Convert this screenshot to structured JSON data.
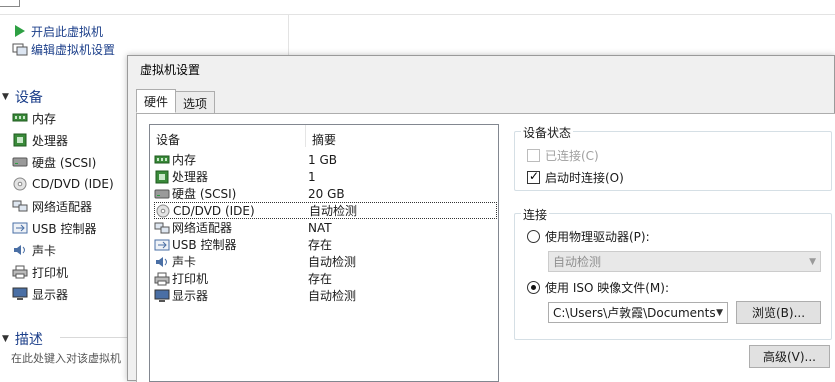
{
  "background": {
    "actions": [
      {
        "label": "开启此虚拟机",
        "icon": "play-icon"
      },
      {
        "label": "编辑虚拟机设置",
        "icon": "edit-settings-icon"
      }
    ],
    "devices_section": "设备",
    "devices": [
      {
        "label": "内存",
        "icon": "memory-icon"
      },
      {
        "label": "处理器",
        "icon": "processor-icon"
      },
      {
        "label": "硬盘 (SCSI)",
        "icon": "hard-disk-icon"
      },
      {
        "label": "CD/DVD (IDE)",
        "icon": "cd-dvd-icon"
      },
      {
        "label": "网络适配器",
        "icon": "network-adapter-icon"
      },
      {
        "label": "USB 控制器",
        "icon": "usb-controller-icon"
      },
      {
        "label": "声卡",
        "icon": "sound-card-icon"
      },
      {
        "label": "打印机",
        "icon": "printer-icon"
      },
      {
        "label": "显示器",
        "icon": "display-icon"
      }
    ],
    "description_section": "描述",
    "description_placeholder": "在此处键入对该虚拟机"
  },
  "dialog": {
    "title": "虚拟机设置",
    "tabs": [
      {
        "label": "硬件",
        "active": true
      },
      {
        "label": "选项",
        "active": false
      }
    ],
    "device_table": {
      "columns": [
        "设备",
        "摘要"
      ],
      "rows": [
        {
          "device": "内存",
          "summary": "1 GB",
          "icon": "memory-icon"
        },
        {
          "device": "处理器",
          "summary": "1",
          "icon": "processor-icon"
        },
        {
          "device": "硬盘 (SCSI)",
          "summary": "20 GB",
          "icon": "hard-disk-icon"
        },
        {
          "device": "CD/DVD (IDE)",
          "summary": "自动检测",
          "icon": "cd-dvd-icon",
          "selected": true
        },
        {
          "device": "网络适配器",
          "summary": "NAT",
          "icon": "network-adapter-icon"
        },
        {
          "device": "USB 控制器",
          "summary": "存在",
          "icon": "usb-controller-icon"
        },
        {
          "device": "声卡",
          "summary": "自动检测",
          "icon": "sound-card-icon"
        },
        {
          "device": "打印机",
          "summary": "存在",
          "icon": "printer-icon"
        },
        {
          "device": "显示器",
          "summary": "自动检测",
          "icon": "display-icon"
        }
      ]
    },
    "device_status": {
      "title": "设备状态",
      "connected_label": "已连接(C)",
      "connected_checked": false,
      "connected_enabled": false,
      "connect_on_start_label": "启动时连接(O)",
      "connect_on_start_checked": true
    },
    "connection": {
      "title": "连接",
      "physical_drive_label": "使用物理驱动器(P):",
      "physical_drive_selected": false,
      "physical_drive_value": "自动检测",
      "iso_label": "使用 ISO 映像文件(M):",
      "iso_selected": true,
      "iso_path": "C:\\Users\\卢敦霞\\Documents",
      "browse_label": "浏览(B)..."
    },
    "advanced_label": "高级(V)..."
  },
  "colors": {
    "link_blue": "#1c3f8a",
    "dialog_bg": "#f0f0f0",
    "play_green": "#2ea043"
  }
}
